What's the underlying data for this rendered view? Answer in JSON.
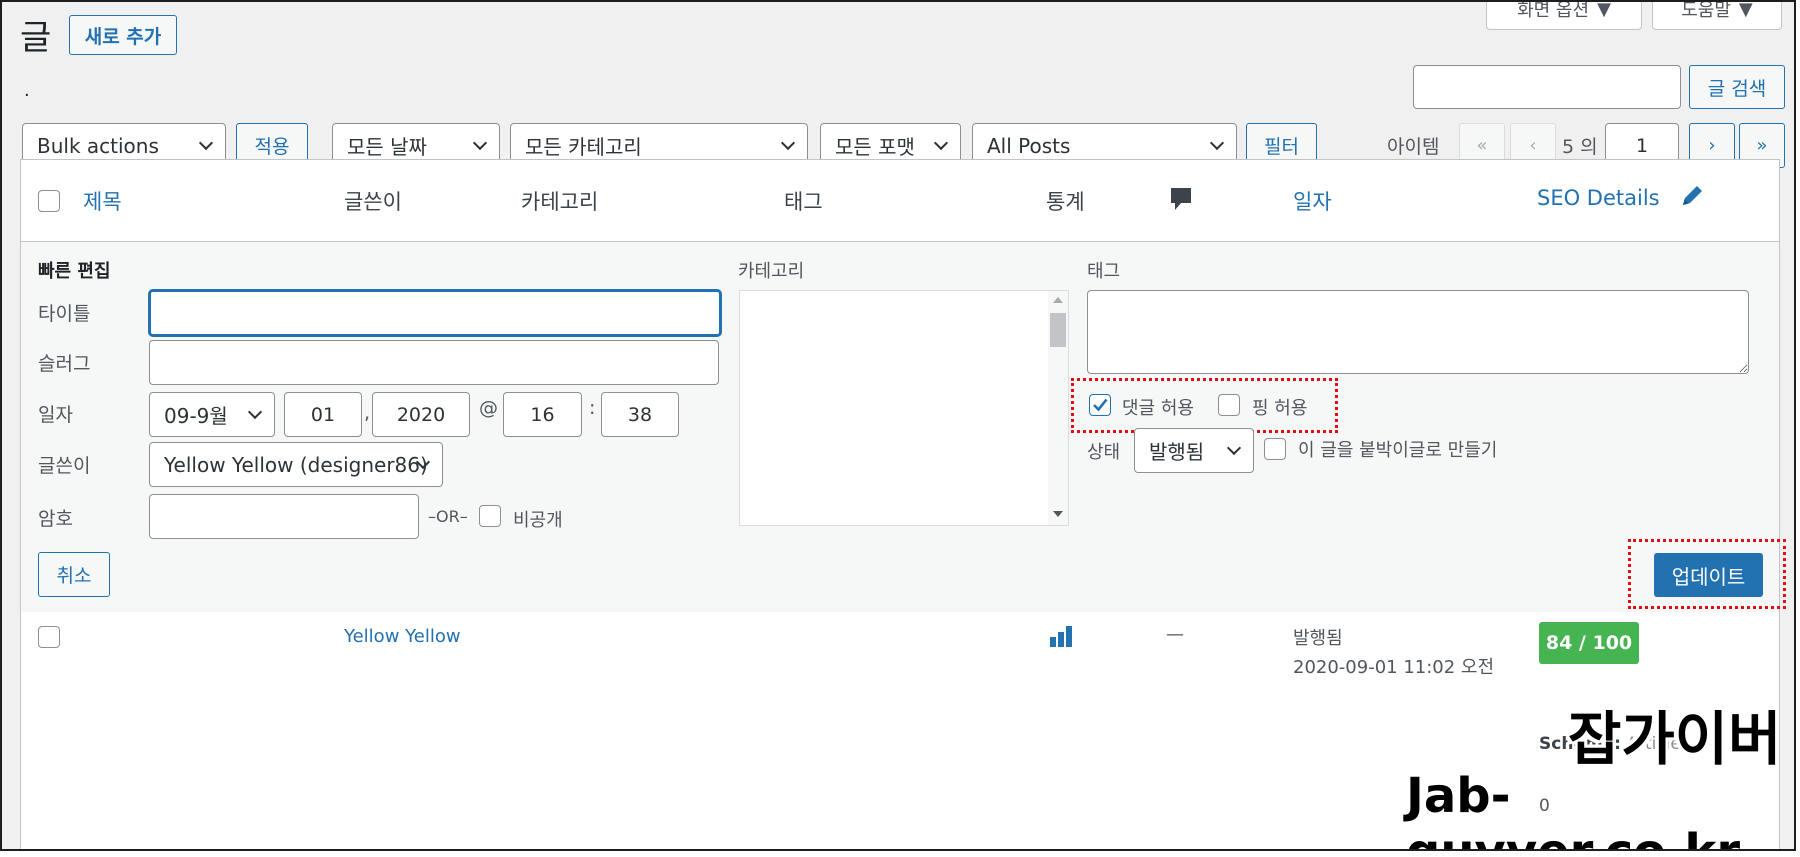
{
  "page": {
    "title": "글",
    "add_new": "새로 추가",
    "screen_options": "화면 옵션",
    "help": "도움말",
    "stray_mark": "."
  },
  "search": {
    "placeholder": "",
    "button": "글 검색"
  },
  "filters": {
    "bulk_actions": "Bulk actions",
    "apply": "적용",
    "all_dates": "모든 날짜",
    "all_categories": "모든 카테고리",
    "all_formats": "모든 포맷",
    "all_posts": "All Posts",
    "filter": "필터"
  },
  "pagination": {
    "items_label": "아이템",
    "first": "«",
    "prev": "‹",
    "of_text": "5 의",
    "current_page": "1",
    "next": "›",
    "last": "»"
  },
  "table": {
    "columns": {
      "title": "제목",
      "author": "글쓴이",
      "categories": "카테고리",
      "tags": "태그",
      "stats": "통계",
      "date": "일자",
      "seo": "SEO Details"
    }
  },
  "quick_edit": {
    "heading": "빠른 편집",
    "title_label": "타이틀",
    "slug_label": "슬러그",
    "date_label": "일자",
    "month": "09-9월",
    "day": "01",
    "year": "2020",
    "at": "@",
    "hour": "16",
    "colon": ":",
    "minute": "38",
    "comma": ",",
    "author_label": "글쓴이",
    "author_value": "Yellow Yellow (designer86)",
    "password_label": "암호",
    "or_text": "–OR–",
    "private_label": "비공개",
    "categories_label": "카테고리",
    "tags_label": "태그",
    "allow_comments": "댓글 허용",
    "allow_pings": "핑 허용",
    "status_label": "상태",
    "status_value": "발행됨",
    "sticky_label": "이 글을 붙박이글로 만들기",
    "cancel": "취소",
    "update": "업데이트"
  },
  "row": {
    "author": "Yellow Yellow",
    "comments": "—",
    "status": "발행됨",
    "date": "2020-09-01 11:02 오전",
    "seo_score": "84 / 100",
    "schema_label": "Schema:",
    "schema_value": "Article",
    "extra": "0"
  },
  "watermark": {
    "korean": "잡가이버",
    "url": "Jab-guyver.co.kr"
  },
  "colors": {
    "accent": "#2271b1",
    "seo_green": "#46b450",
    "highlight_red": "#e01010"
  }
}
